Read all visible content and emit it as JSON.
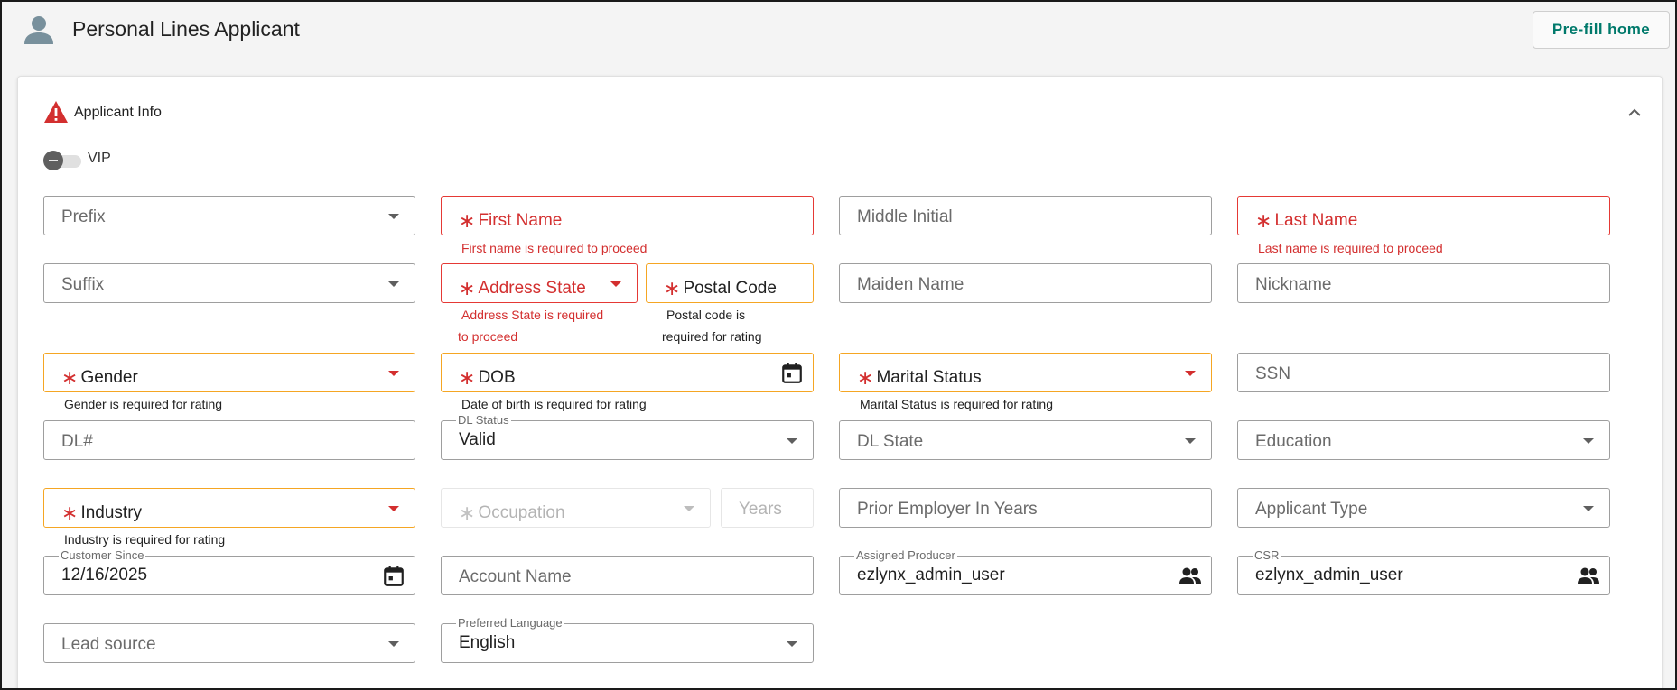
{
  "header": {
    "title": "Personal Lines Applicant",
    "prefill_label": "Pre-fill home"
  },
  "section": {
    "title": "Applicant Info",
    "vip_label": "VIP",
    "vip_on": false
  },
  "required_marker": "∗",
  "fields": {
    "prefix": {
      "placeholder": "Prefix"
    },
    "first_name": {
      "placeholder": "First Name",
      "error": "First name is required to proceed"
    },
    "middle_initial": {
      "placeholder": "Middle Initial"
    },
    "last_name": {
      "placeholder": "Last Name",
      "error": "Last name is required to proceed"
    },
    "suffix": {
      "placeholder": "Suffix"
    },
    "address_state": {
      "placeholder": "Address State",
      "error_line1": "Address State is required",
      "error_line2": "to proceed"
    },
    "postal_code": {
      "placeholder": "Postal Code",
      "hint_line1": "Postal code is",
      "hint_line2": "required for rating"
    },
    "maiden_name": {
      "placeholder": "Maiden Name"
    },
    "nickname": {
      "placeholder": "Nickname"
    },
    "gender": {
      "placeholder": "Gender",
      "hint": "Gender is required for rating"
    },
    "dob": {
      "placeholder": "DOB",
      "hint": "Date of birth is required for rating"
    },
    "marital_status": {
      "placeholder": "Marital Status",
      "hint": "Marital Status is required for rating"
    },
    "ssn": {
      "placeholder": "SSN"
    },
    "dl_number": {
      "placeholder": "DL#"
    },
    "dl_status": {
      "label": "DL Status",
      "value": "Valid"
    },
    "dl_state": {
      "placeholder": "DL State"
    },
    "education": {
      "placeholder": "Education"
    },
    "industry": {
      "placeholder": "Industry",
      "hint": "Industry is required for rating"
    },
    "occupation": {
      "placeholder": "Occupation"
    },
    "years": {
      "placeholder": "Years"
    },
    "prior_employer": {
      "placeholder": "Prior Employer In Years"
    },
    "applicant_type": {
      "placeholder": "Applicant Type"
    },
    "customer_since": {
      "label": "Customer Since",
      "value": "12/16/2025"
    },
    "account_name": {
      "placeholder": "Account Name"
    },
    "assigned_producer": {
      "label": "Assigned Producer",
      "value": "ezlynx_admin_user"
    },
    "csr": {
      "label": "CSR",
      "value": "ezlynx_admin_user"
    },
    "lead_source": {
      "placeholder": "Lead source"
    },
    "preferred_language": {
      "label": "Preferred Language",
      "value": "English"
    }
  },
  "colors": {
    "accent": "#00796b",
    "error": "#d32f2f",
    "warning_border": "#f5a623"
  }
}
